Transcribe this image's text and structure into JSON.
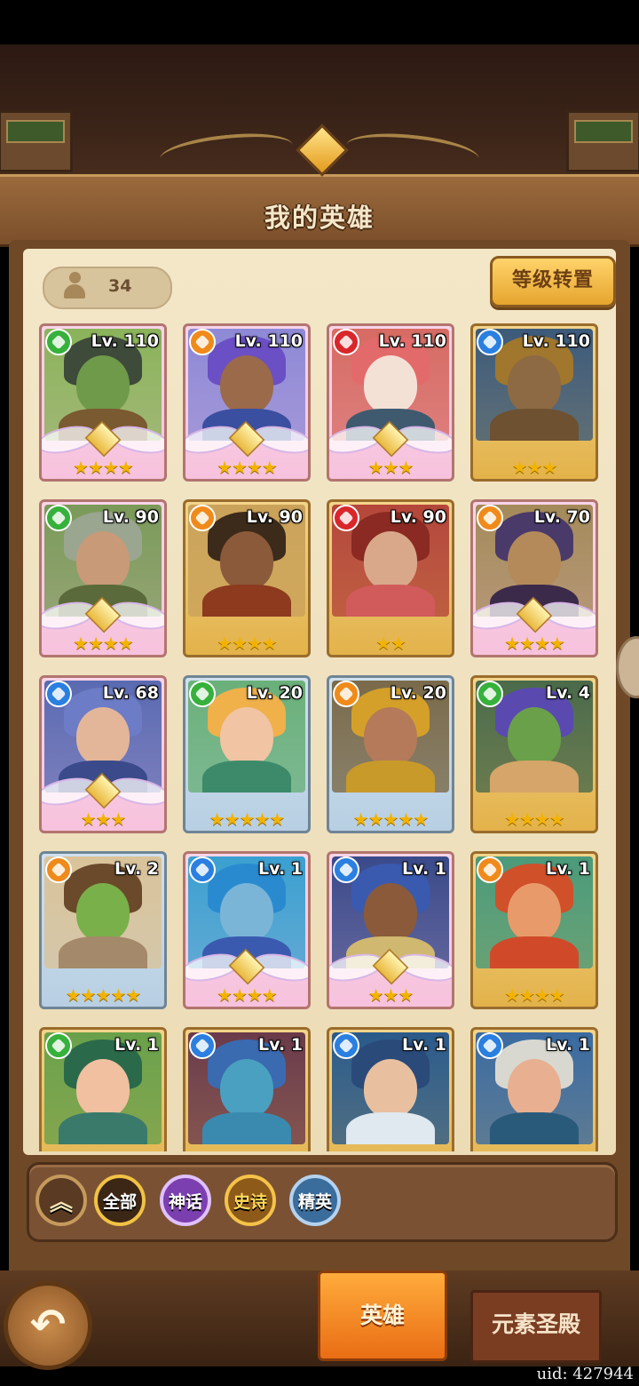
{
  "header": {
    "title": "我的英雄"
  },
  "toolbar": {
    "hero_count": "34",
    "level_transfer_label": "等级转置"
  },
  "heroes": [
    {
      "level": "Lv. 110",
      "element": "wind",
      "rarity": "mythic",
      "stars": "★★★★",
      "portrait": {
        "skin": "#6f9a4a",
        "hair": "#3e4a3a",
        "bg": "#8ab35a",
        "body": "#7a5a30"
      }
    },
    {
      "level": "Lv. 110",
      "element": "fire",
      "rarity": "mythic",
      "stars": "★★★★",
      "portrait": {
        "skin": "#9b6a4a",
        "hair": "#6b4fc4",
        "bg": "#8d89d6",
        "body": "#3a4fa0"
      }
    },
    {
      "level": "Lv. 110",
      "element": "blood",
      "rarity": "mythic",
      "stars": "★★★",
      "portrait": {
        "skin": "#f4e1d6",
        "hair": "#e36a6a",
        "bg": "#d66b63",
        "body": "#3f5a6f"
      }
    },
    {
      "level": "Lv. 110",
      "element": "water",
      "rarity": "epic",
      "stars": "★★★",
      "portrait": {
        "skin": "#8d6a44",
        "hair": "#a0772d",
        "bg": "#3c5a7a",
        "body": "#6e5130"
      }
    },
    {
      "level": "Lv. 90",
      "element": "wind",
      "rarity": "mythic",
      "stars": "★★★★",
      "portrait": {
        "skin": "#c89a78",
        "hair": "#9aa690",
        "bg": "#7a9a58",
        "body": "#5a6a3a"
      }
    },
    {
      "level": "Lv. 90",
      "element": "fire",
      "rarity": "epic",
      "stars": "★★★★",
      "portrait": {
        "skin": "#8a5a3a",
        "hair": "#3c2a1a",
        "bg": "#caa25a",
        "body": "#8d3a1e"
      }
    },
    {
      "level": "Lv. 90",
      "element": "blood",
      "rarity": "epic",
      "stars": "★★",
      "portrait": {
        "skin": "#d9a88a",
        "hair": "#8a2a22",
        "bg": "#b4463a",
        "body": "#d15a5a"
      }
    },
    {
      "level": "Lv. 70",
      "element": "fire",
      "rarity": "mythic",
      "stars": "★★★★",
      "portrait": {
        "skin": "#b48a5a",
        "hair": "#4a3a6a",
        "bg": "#a48a5a",
        "body": "#3c2a4a"
      }
    },
    {
      "level": "Lv. 68",
      "element": "water",
      "rarity": "mythic",
      "stars": "★★★",
      "portrait": {
        "skin": "#e3b69a",
        "hair": "#6d7cc6",
        "bg": "#5a6ab2",
        "body": "#3a4a8a"
      }
    },
    {
      "level": "Lv. 20",
      "element": "wind",
      "rarity": "elite",
      "stars": "★★★★★",
      "portrait": {
        "skin": "#f1c4a4",
        "hair": "#f0b04a",
        "bg": "#6ab07a",
        "body": "#3c8a6a"
      }
    },
    {
      "level": "Lv. 20",
      "element": "fire",
      "rarity": "elite",
      "stars": "★★★★★",
      "portrait": {
        "skin": "#b47a5a",
        "hair": "#d4a02a",
        "bg": "#7a6a4a",
        "body": "#c89a2a"
      }
    },
    {
      "level": "Lv. 4",
      "element": "wind",
      "rarity": "epic",
      "stars": "★★★★",
      "portrait": {
        "skin": "#6aa04a",
        "hair": "#5a4ab0",
        "bg": "#4a6a4a",
        "body": "#d5a56a"
      }
    },
    {
      "level": "Lv. 2",
      "element": "fire",
      "rarity": "elite",
      "stars": "★★★★★",
      "portrait": {
        "skin": "#7ab04a",
        "hair": "#6a4a2a",
        "bg": "#d9c39a",
        "body": "#a48a6a"
      }
    },
    {
      "level": "Lv. 1",
      "element": "water",
      "rarity": "mythic",
      "stars": "★★★★",
      "portrait": {
        "skin": "#7ab5d8",
        "hair": "#2a8ad0",
        "bg": "#3aa0d0",
        "body": "#3a5ab0"
      }
    },
    {
      "level": "Lv. 1",
      "element": "water",
      "rarity": "mythic",
      "stars": "★★★",
      "portrait": {
        "skin": "#8a5a3a",
        "hair": "#3a5ab0",
        "bg": "#3a4a8a",
        "body": "#d0b870"
      }
    },
    {
      "level": "Lv. 1",
      "element": "fire",
      "rarity": "epic",
      "stars": "★★★★",
      "portrait": {
        "skin": "#e89a6a",
        "hair": "#d0502a",
        "bg": "#4a9a7a",
        "body": "#d04a2a"
      }
    },
    {
      "level": "Lv. 1",
      "element": "wind",
      "rarity": "epic",
      "stars": "",
      "portrait": {
        "skin": "#f0c0a0",
        "hair": "#2a6a4a",
        "bg": "#6aa04a",
        "body": "#3a7a6a"
      }
    },
    {
      "level": "Lv. 1",
      "element": "water",
      "rarity": "epic",
      "stars": "",
      "portrait": {
        "skin": "#4aa0c0",
        "hair": "#3a6ab0",
        "bg": "#6a3a4a",
        "body": "#3a8ab0"
      }
    },
    {
      "level": "Lv. 1",
      "element": "water",
      "rarity": "epic",
      "stars": "",
      "portrait": {
        "skin": "#e8c0a0",
        "hair": "#2a4a7a",
        "bg": "#2a5a8a",
        "body": "#e0e8f0"
      }
    },
    {
      "level": "Lv. 1",
      "element": "water",
      "rarity": "epic",
      "stars": "",
      "portrait": {
        "skin": "#e8b090",
        "hair": "#d8d8d0",
        "bg": "#3a6aa0",
        "body": "#2a5a7a"
      }
    }
  ],
  "element_colors": {
    "wind": "#36b13b",
    "fire": "#f08a1a",
    "blood": "#d9262a",
    "water": "#2a7fe0"
  },
  "filters": {
    "collapse_icon": "chevrons-up-icon",
    "all": "全部",
    "mythic": "神话",
    "epic": "史诗",
    "elite": "精英"
  },
  "bottom": {
    "back_icon": "back-arrow-icon",
    "tab_heroes": "英雄",
    "tab_temple": "元素圣殿",
    "uid": "uid: 427944"
  }
}
